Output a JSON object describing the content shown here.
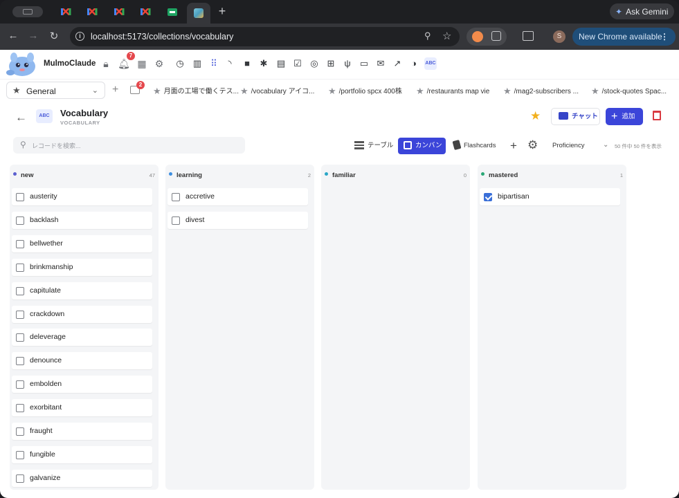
{
  "browser": {
    "tabs": [
      {
        "favicon": "gmail-icon"
      },
      {
        "favicon": "gmail-icon"
      },
      {
        "favicon": "gmail-icon"
      },
      {
        "favicon": "gmail-icon"
      },
      {
        "favicon": "sheets-icon"
      },
      {
        "favicon": "map-icon",
        "active": true
      }
    ],
    "ask_gemini": "Ask Gemini",
    "url": "localhost:5173/collections/vocabulary",
    "profile_initial": "S",
    "update_button": "New Chrome available"
  },
  "app": {
    "brand": "MulmoClaude",
    "notifications_count": "7",
    "inbox_count": "2",
    "plugin_icons": [
      "clock-icon",
      "book-icon",
      "grid-icon",
      "rss-icon",
      "folder-icon",
      "bug-icon",
      "calendar-icon",
      "checklist-icon",
      "podcast-icon",
      "chip-icon",
      "restaurant-icon",
      "movie-icon",
      "mail-icon",
      "trend-icon",
      "pie-icon",
      "abc-icon"
    ],
    "selected_plugin_label": "ABC"
  },
  "bookmarks": {
    "selector_label": "General",
    "items": [
      "月面の工場で働くテス...",
      "/vocabulary アイコ...",
      "/portfolio spcx 400株",
      "/restaurants map vie",
      "/mag2-subscribers ...",
      "/stock-quotes Spac..."
    ]
  },
  "collection": {
    "icon_label": "ABC",
    "title": "Vocabulary",
    "subtitle": "VOCABULARY",
    "chat_label": "チャット",
    "add_label": "追加",
    "search_placeholder": "レコードを検索...",
    "views": {
      "table": "テーブル",
      "kanban": "カンバン",
      "flashcards": "Flashcards"
    },
    "active_view": "kanban",
    "group_by": "Proficiency",
    "record_count": "50 件中 50 件を表示"
  },
  "kanban": {
    "columns": [
      {
        "name": "new",
        "count": "47",
        "color": "#5b5fcf",
        "cards": [
          {
            "word": "austerity",
            "checked": false
          },
          {
            "word": "backlash",
            "checked": false
          },
          {
            "word": "bellwether",
            "checked": false
          },
          {
            "word": "brinkmanship",
            "checked": false
          },
          {
            "word": "capitulate",
            "checked": false
          },
          {
            "word": "crackdown",
            "checked": false
          },
          {
            "word": "deleverage",
            "checked": false
          },
          {
            "word": "denounce",
            "checked": false
          },
          {
            "word": "embolden",
            "checked": false
          },
          {
            "word": "exorbitant",
            "checked": false
          },
          {
            "word": "fraught",
            "checked": false
          },
          {
            "word": "fungible",
            "checked": false
          },
          {
            "word": "galvanize",
            "checked": false
          }
        ]
      },
      {
        "name": "learning",
        "count": "2",
        "color": "#3d8fe0",
        "cards": [
          {
            "word": "accretive",
            "checked": false
          },
          {
            "word": "divest",
            "checked": false
          }
        ]
      },
      {
        "name": "familiar",
        "count": "0",
        "color": "#2aa7c7",
        "cards": []
      },
      {
        "name": "mastered",
        "count": "1",
        "color": "#2aa876",
        "cards": [
          {
            "word": "bipartisan",
            "checked": true
          }
        ]
      }
    ]
  }
}
